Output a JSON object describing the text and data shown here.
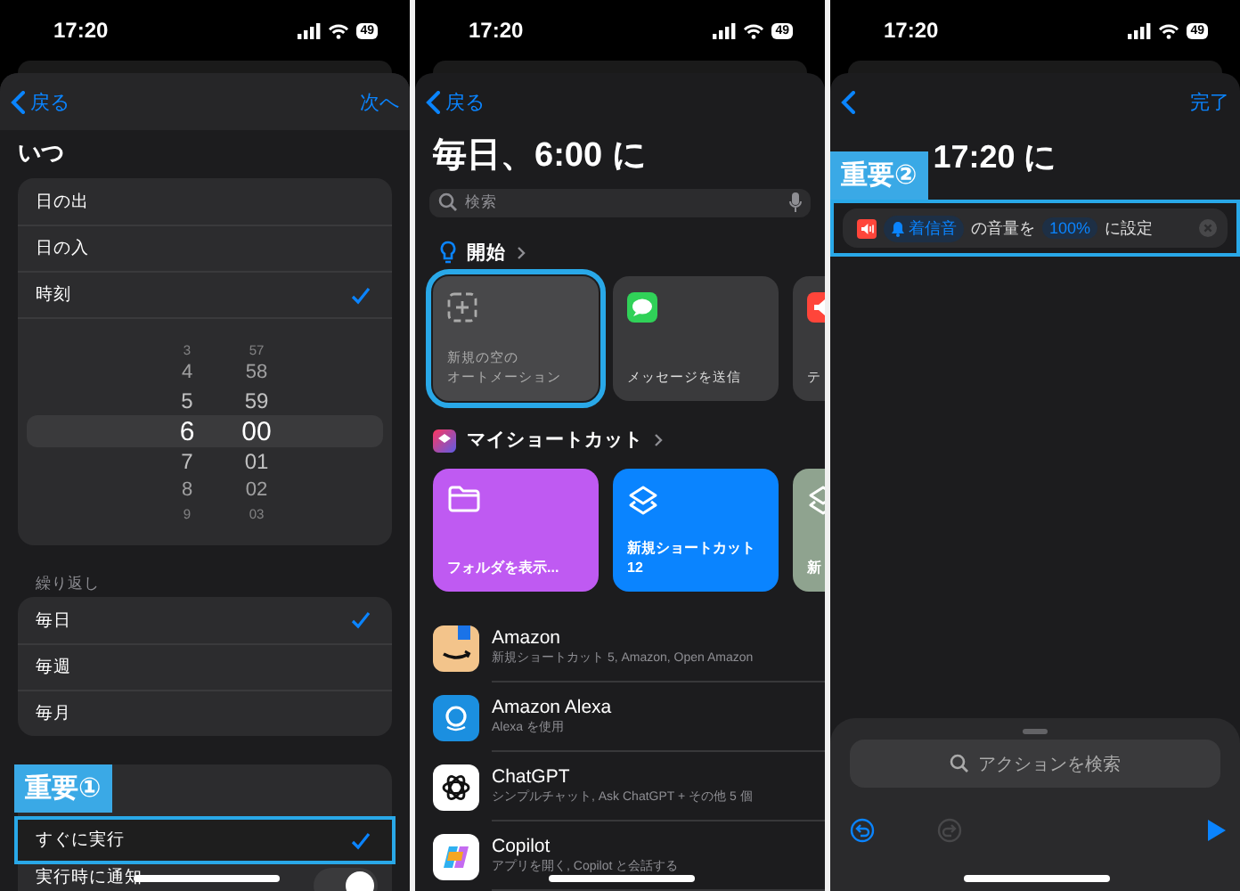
{
  "left_screen": {
    "status_bar": {
      "time": "17:20",
      "battery": "49"
    },
    "nav": {
      "back": "戻る",
      "next": "次へ"
    },
    "section_title": "いつ",
    "when_options": [
      {
        "label": "日の出",
        "selected": false
      },
      {
        "label": "日の入",
        "selected": false
      },
      {
        "label": "時刻",
        "selected": true
      }
    ],
    "time_picker": [
      {
        "hour": "3",
        "minute": "57",
        "selected": false
      },
      {
        "hour": "4",
        "minute": "58",
        "selected": false
      },
      {
        "hour": "5",
        "minute": "59",
        "selected": false
      },
      {
        "hour": "6",
        "minute": "00",
        "selected": true
      },
      {
        "hour": "7",
        "minute": "01",
        "selected": false
      },
      {
        "hour": "8",
        "minute": "02",
        "selected": false
      },
      {
        "hour": "9",
        "minute": "03",
        "selected": false
      }
    ],
    "repeat_title": "繰り返し",
    "repeat_options": [
      {
        "label": "毎日",
        "selected": true
      },
      {
        "label": "毎週",
        "selected": false
      },
      {
        "label": "毎月",
        "selected": false
      }
    ],
    "callout": "重要①",
    "run_immediately": {
      "label": "すぐに実行",
      "checked": true
    },
    "notify": {
      "label": "実行時に通知",
      "on": true
    }
  },
  "middle_screen": {
    "status_bar": {
      "time": "17:20",
      "battery": "49"
    },
    "back": "戻る",
    "title": "毎日、6:00 に",
    "search": {
      "placeholder": "検索"
    },
    "start": {
      "title": "開始",
      "cards": [
        {
          "kind": "new",
          "lines": [
            "新規の空の",
            "オートメーション"
          ],
          "highlighted": true
        },
        {
          "kind": "message",
          "lines": [
            "メッセージを送信"
          ],
          "highlighted": false
        },
        {
          "kind": "sound",
          "lines": [
            "テ"
          ],
          "highlighted": false
        }
      ]
    },
    "my_shortcuts": {
      "title": "マイショートカット",
      "cards": [
        {
          "kind": "folder",
          "label": "フォルダを表示...",
          "color": "#bf5af2"
        },
        {
          "kind": "shortcut",
          "label": "新規ショートカット",
          "count": "12",
          "color": "#0a84ff"
        },
        {
          "kind": "shortcut",
          "label": "新",
          "color": "#8fa38f"
        }
      ]
    },
    "apps": [
      {
        "kind": "amazon",
        "name": "Amazon",
        "subtitle": "新規ショートカット 5, Amazon, Open Amazon"
      },
      {
        "kind": "alexa",
        "name": "Amazon Alexa",
        "subtitle": "Alexa を使用"
      },
      {
        "kind": "chatgpt",
        "name": "ChatGPT",
        "subtitle": "シンプルチャット, Ask ChatGPT + その他 5 個"
      },
      {
        "kind": "copilot",
        "name": "Copilot",
        "subtitle": "アプリを開く, Copilot と会話する"
      }
    ]
  },
  "right_screen": {
    "status_bar": {
      "time": "17:20",
      "battery": "49"
    },
    "done": "完了",
    "title": "17:20 に",
    "callout": "重要②",
    "action": {
      "parameter": "着信音",
      "text_before": "の音量を",
      "value": "100%",
      "text_after": "に設定"
    },
    "search": {
      "placeholder": "アクションを検索"
    },
    "toolbar": {
      "undo": {
        "disabled": false
      },
      "redo": {
        "disabled": true
      }
    }
  }
}
